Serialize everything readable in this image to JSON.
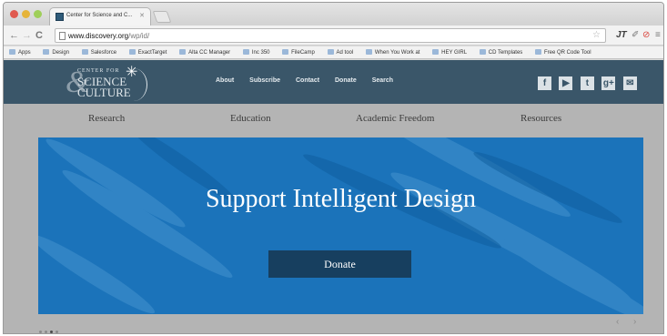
{
  "browser": {
    "tab_title": "Center for Science and C...",
    "url_host": "www.discovery.org",
    "url_path": "/wp/id/",
    "bookmarks": [
      "Apps",
      "Design",
      "Salesforce",
      "ExactTarget",
      "Alta CC Manager",
      "Inc 350",
      "FileCamp",
      "Ad tool",
      "When You Work at",
      "HEY GIRL",
      "CD Templates",
      "Free QR Code Tool"
    ],
    "extension_label": "JT"
  },
  "site": {
    "logo": {
      "line1": "CENTER FOR",
      "line2": "SCIENCE",
      "line3": "CULTURE",
      "ampersand": "&"
    },
    "top_nav": [
      "About",
      "Subscribe",
      "Contact",
      "Donate",
      "Search"
    ],
    "social_icons": [
      "f",
      "▶",
      "t",
      "g+",
      "✉"
    ],
    "main_nav": [
      "Research",
      "Education",
      "Academic Freedom",
      "Resources"
    ],
    "hero": {
      "title": "Support Intelligent Design",
      "button_label": "Donate"
    },
    "colors": {
      "header": "#3a5669",
      "hero": "#1b73ba",
      "button": "#173f5f"
    }
  }
}
